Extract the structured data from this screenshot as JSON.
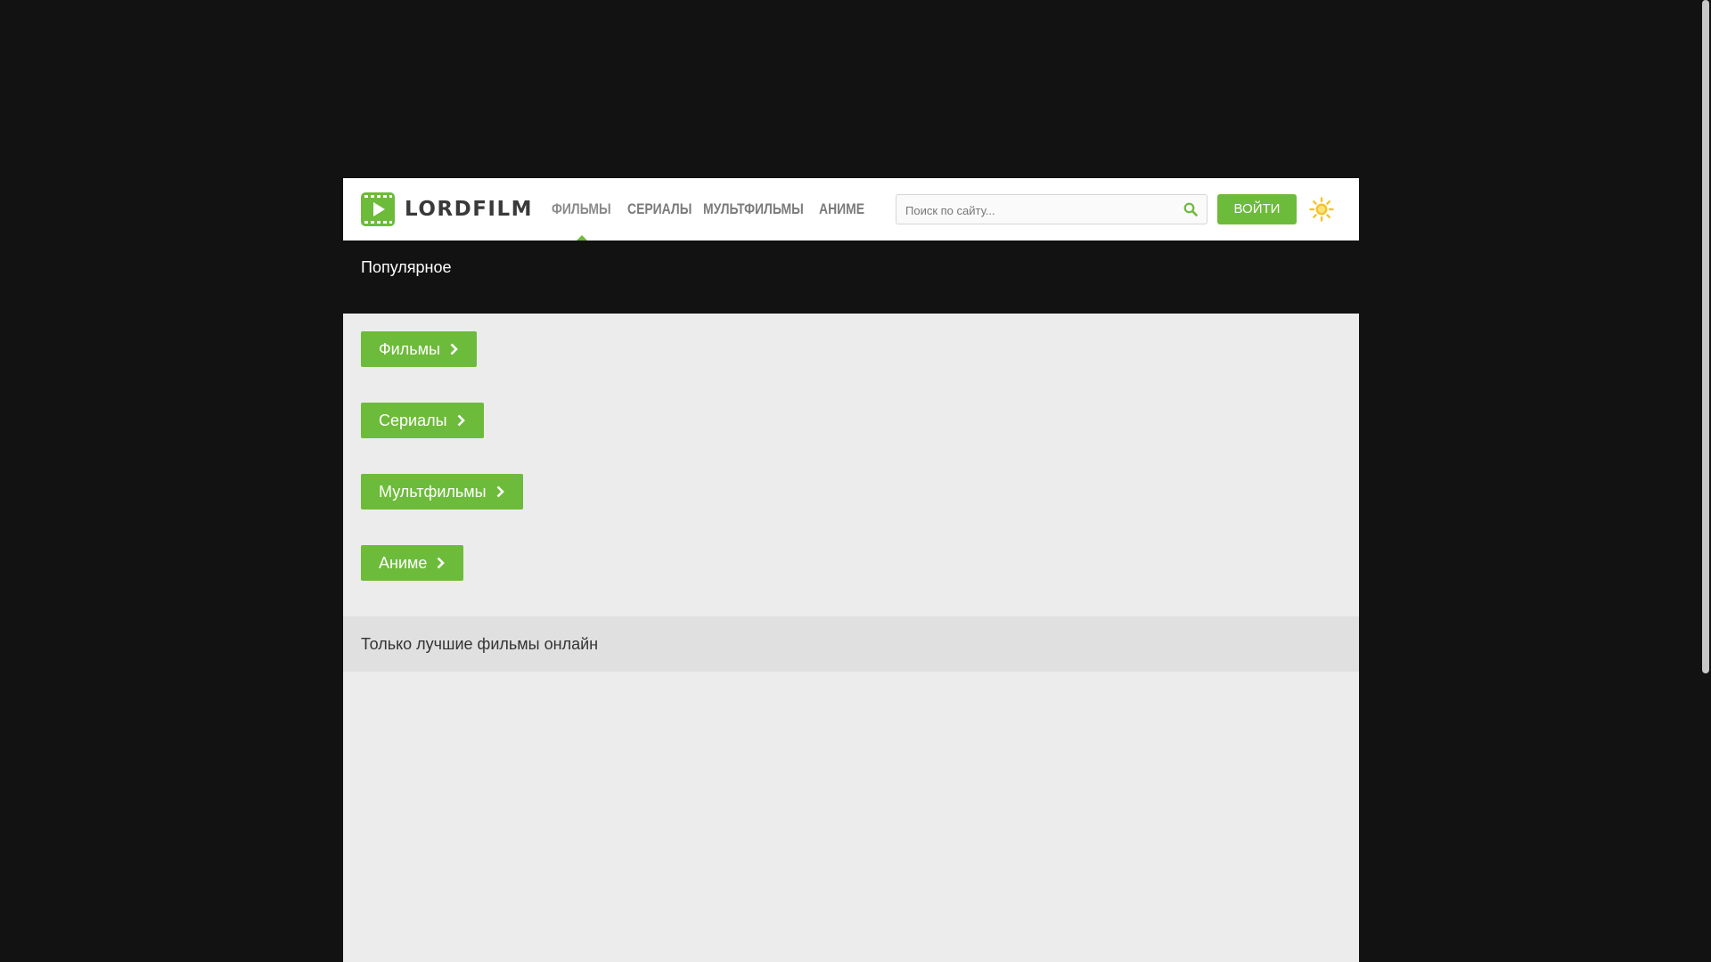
{
  "header": {
    "logo_text": "LORDFILM",
    "nav": [
      {
        "label": "ФИЛЬМЫ",
        "active": true
      },
      {
        "label": "СЕРИАЛЫ"
      },
      {
        "label": "МУЛЬТФИЛЬМЫ"
      },
      {
        "label": "АНИМЕ"
      }
    ],
    "search_placeholder": "Поиск по сайту...",
    "login_label": "ВОЙТИ"
  },
  "popular": {
    "title": "Популярное"
  },
  "categories": [
    {
      "label": "Фильмы"
    },
    {
      "label": "Сериалы"
    },
    {
      "label": "Мультфильмы"
    },
    {
      "label": "Аниме"
    }
  ],
  "best": {
    "title": "Только лучшие фильмы онлайн"
  },
  "colors": {
    "accent": "#6dbb3a",
    "background": "#121212",
    "content": "#ececec",
    "theme_icon": "#f4c430"
  },
  "icons": {
    "logo": "play-film-icon",
    "search": "search-icon",
    "theme": "sun-icon",
    "chevron": "chevron-right-icon"
  }
}
